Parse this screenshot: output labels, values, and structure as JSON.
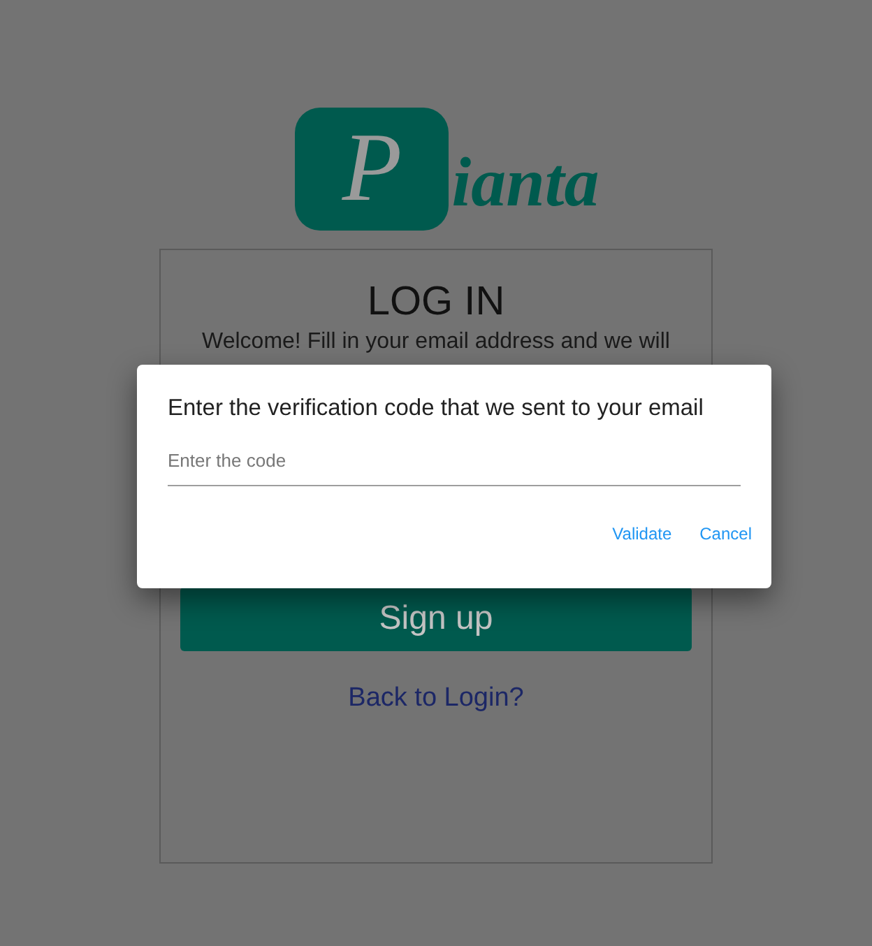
{
  "logo": {
    "initial": "P",
    "rest": "ianta"
  },
  "login_card": {
    "title": "LOG IN",
    "intro": "Welcome! Fill in your email address and we will",
    "primary_button": "Sign up",
    "link": "Back to Login?"
  },
  "dialog": {
    "title": "Enter the verification code that we sent to your email",
    "field": {
      "placeholder": "Enter the code"
    },
    "actions": [
      "Validate",
      "Cancel"
    ]
  }
}
